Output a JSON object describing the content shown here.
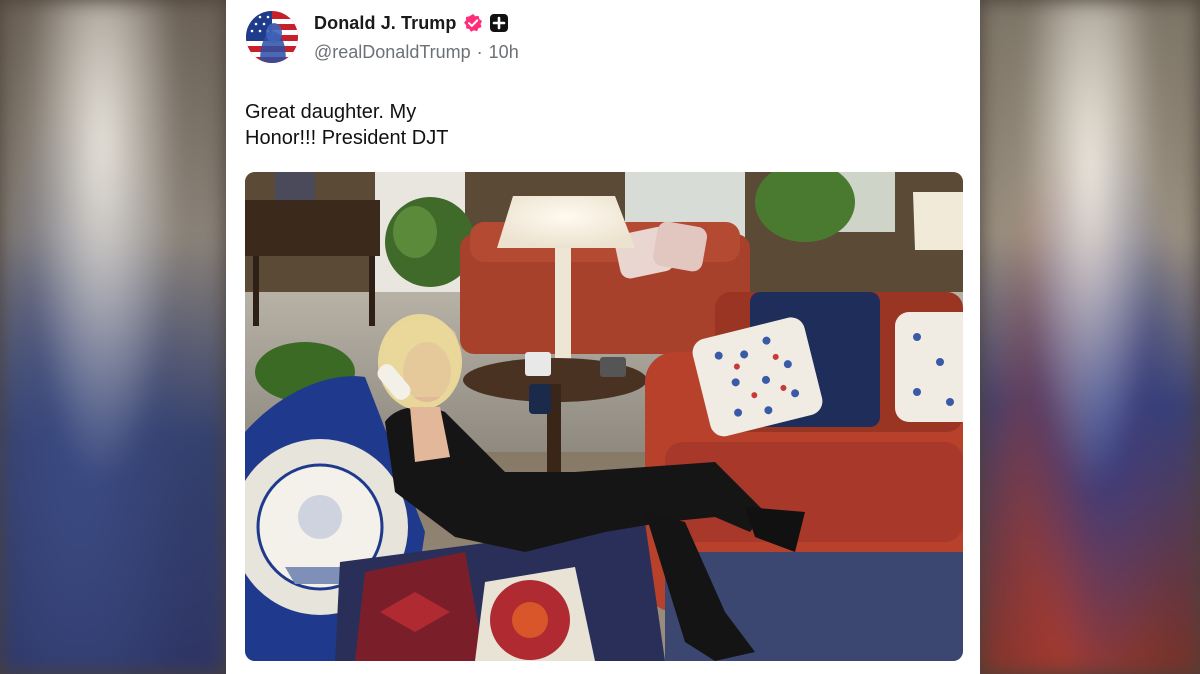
{
  "post": {
    "author": {
      "name": "Donald J. Trump",
      "handle": "@realDonaldTrump",
      "separator": "·",
      "time": "10h",
      "verified_icon": "verified-badge-icon",
      "plus_icon": "plus-badge-icon"
    },
    "text_lines": [
      "Great daughter. My",
      "Honor!!! President DJT"
    ],
    "media": {
      "kind": "photo",
      "icon": "photo-media"
    }
  },
  "colors": {
    "verified_pink": "#ff2e7a",
    "handle_gray": "#6b7177",
    "text": "#111111"
  }
}
